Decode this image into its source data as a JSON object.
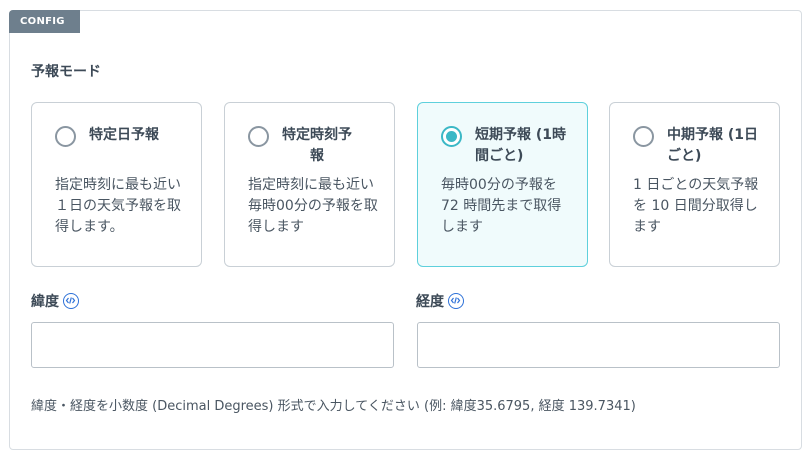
{
  "panel": {
    "tag": "CONFIG"
  },
  "forecast_mode": {
    "label": "予報モード",
    "options": [
      {
        "title": "特定日予報",
        "description": "指定時刻に最も近い１日の天気予報を取得します。",
        "selected": false
      },
      {
        "title": "特定時刻予報",
        "description": "指定時刻に最も近い毎時00分の予報を取得します",
        "selected": false
      },
      {
        "title": "短期予報 (1時間ごと)",
        "description": "毎時00分の予報を72 時間先まで取得します",
        "selected": true
      },
      {
        "title": "中期予報 (1日ごと)",
        "description": "1 日ごとの天気予報を 10 日間分取得します",
        "selected": false
      }
    ]
  },
  "latitude": {
    "label": "緯度",
    "value": "",
    "icon": "info-icon"
  },
  "longitude": {
    "label": "経度",
    "value": "",
    "icon": "info-icon"
  },
  "help_text": "緯度・経度を小数度 (Decimal Degrees) 形式で入力してください (例: 緯度35.6795, 経度 139.7341)",
  "colors": {
    "accent": "#3bb8c6",
    "tag_bg": "#6e7f8d",
    "link_icon": "#2f72d8"
  }
}
